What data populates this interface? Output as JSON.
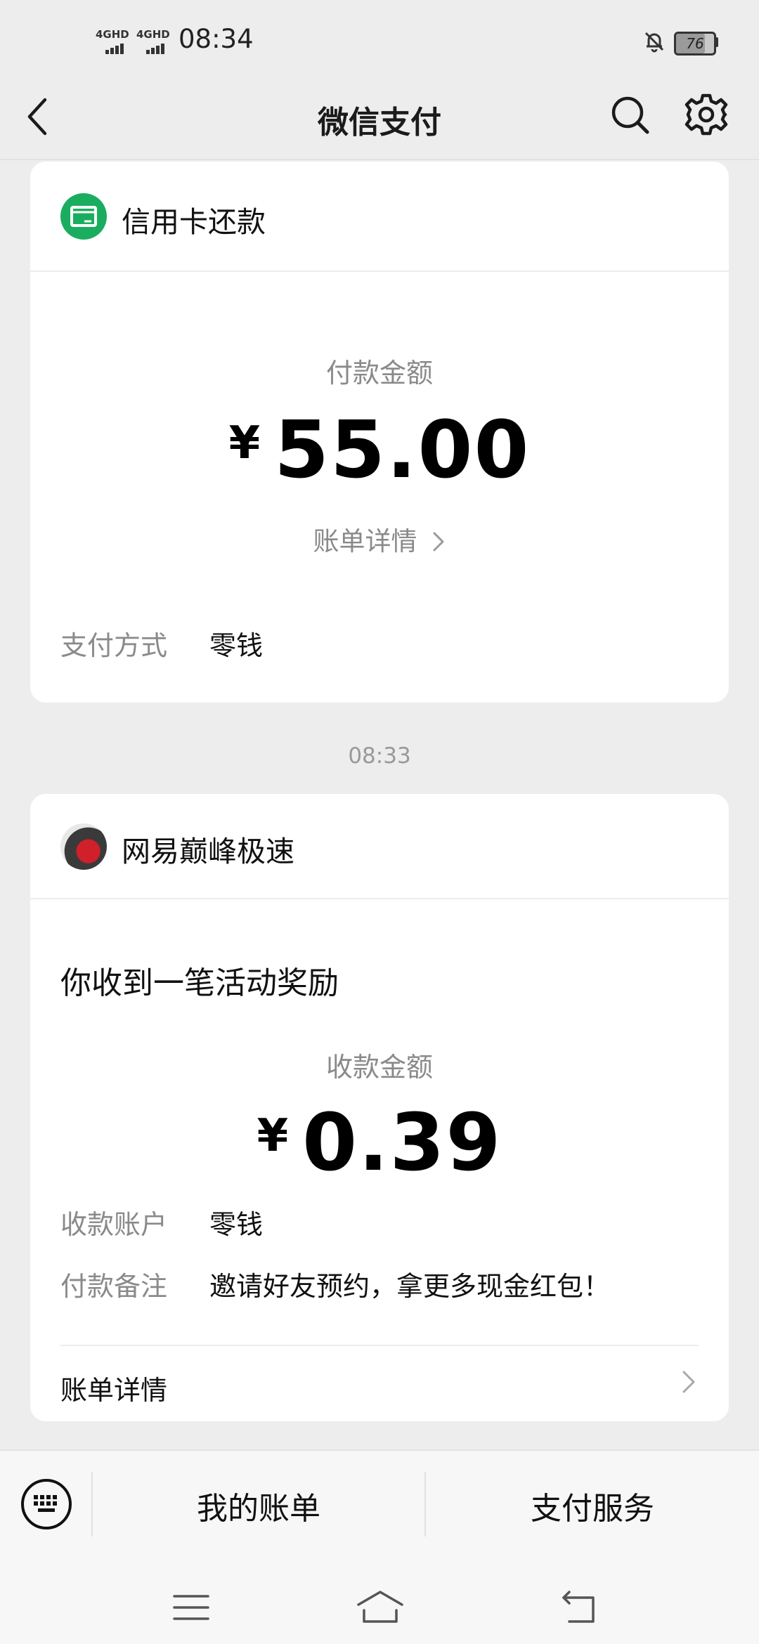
{
  "status_bar": {
    "sim1": "4GHD",
    "sim2": "4GHD",
    "time": "08:34",
    "battery": "76"
  },
  "nav": {
    "title": "微信支付"
  },
  "card1": {
    "merchant": "信用卡还款",
    "amount_label": "付款金额",
    "currency": "¥",
    "amount": "55.00",
    "detail_link": "账单详情",
    "method_label": "支付方式",
    "method_value": "零钱"
  },
  "timestamp": "08:33",
  "card2": {
    "merchant": "网易巅峰极速",
    "headline": "你收到一笔活动奖励",
    "amount_label": "收款金额",
    "currency": "¥",
    "amount": "0.39",
    "account_label": "收款账户",
    "account_value": "零钱",
    "remark_label": "付款备注",
    "remark_value": "邀请好友预约，拿更多现金红包！",
    "detail_link": "账单详情"
  },
  "tab_bar": {
    "bills": "我的账单",
    "services": "支付服务"
  },
  "colors": {
    "wechat_green": "#1aad5f",
    "background": "#ededed"
  }
}
